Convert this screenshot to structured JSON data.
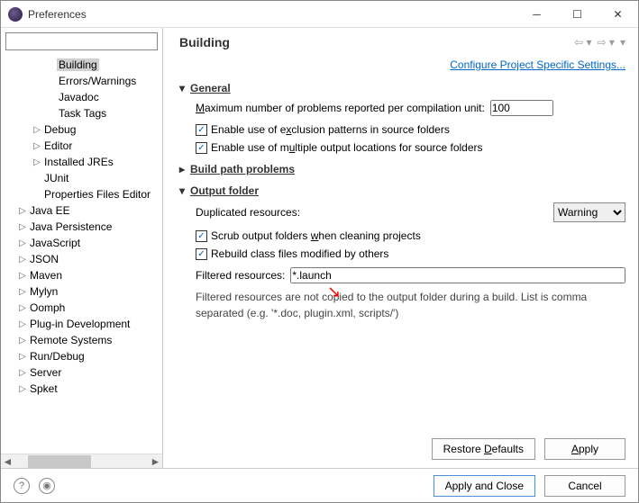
{
  "window": {
    "title": "Preferences"
  },
  "sidebar": {
    "filter_placeholder": "",
    "items": [
      {
        "label": "Building",
        "depth": 3,
        "expandable": false,
        "selected": true
      },
      {
        "label": "Errors/Warnings",
        "depth": 3,
        "expandable": false
      },
      {
        "label": "Javadoc",
        "depth": 3,
        "expandable": false
      },
      {
        "label": "Task Tags",
        "depth": 3,
        "expandable": false
      },
      {
        "label": "Debug",
        "depth": 2,
        "expandable": true
      },
      {
        "label": "Editor",
        "depth": 2,
        "expandable": true
      },
      {
        "label": "Installed JREs",
        "depth": 2,
        "expandable": true
      },
      {
        "label": "JUnit",
        "depth": 2,
        "expandable": false
      },
      {
        "label": "Properties Files Editor",
        "depth": 2,
        "expandable": false
      },
      {
        "label": "Java EE",
        "depth": 1,
        "expandable": true
      },
      {
        "label": "Java Persistence",
        "depth": 1,
        "expandable": true
      },
      {
        "label": "JavaScript",
        "depth": 1,
        "expandable": true
      },
      {
        "label": "JSON",
        "depth": 1,
        "expandable": true
      },
      {
        "label": "Maven",
        "depth": 1,
        "expandable": true
      },
      {
        "label": "Mylyn",
        "depth": 1,
        "expandable": true
      },
      {
        "label": "Oomph",
        "depth": 1,
        "expandable": true
      },
      {
        "label": "Plug-in Development",
        "depth": 1,
        "expandable": true
      },
      {
        "label": "Remote Systems",
        "depth": 1,
        "expandable": true
      },
      {
        "label": "Run/Debug",
        "depth": 1,
        "expandable": true
      },
      {
        "label": "Server",
        "depth": 1,
        "expandable": true
      },
      {
        "label": "Spket",
        "depth": 1,
        "expandable": true
      }
    ]
  },
  "page": {
    "title": "Building",
    "config_link": "Configure Project Specific Settings...",
    "general": {
      "heading": "General",
      "max_problems_label": "Maximum number of problems reported per compilation unit:",
      "max_problems_value": "100",
      "exclusion_label": "Enable use of exclusion patterns in source folders",
      "exclusion_checked": true,
      "multiple_output_label": "Enable use of multiple output locations for source folders",
      "multiple_output_checked": true
    },
    "build_path": {
      "heading": "Build path problems"
    },
    "output": {
      "heading": "Output folder",
      "duplicated_label": "Duplicated resources:",
      "duplicated_value": "Warning",
      "scrub_label": "Scrub output folders when cleaning projects",
      "scrub_checked": true,
      "rebuild_label": "Rebuild class files modified by others",
      "rebuild_checked": true,
      "filtered_label": "Filtered resources:",
      "filtered_value": "*.launch",
      "hint": "Filtered resources are not copied to the output folder during a build. List is comma separated (e.g. '*.doc, plugin.xml, scripts/')"
    },
    "restore_defaults": "Restore Defaults",
    "apply": "Apply"
  },
  "footer": {
    "apply_close": "Apply and Close",
    "cancel": "Cancel"
  }
}
